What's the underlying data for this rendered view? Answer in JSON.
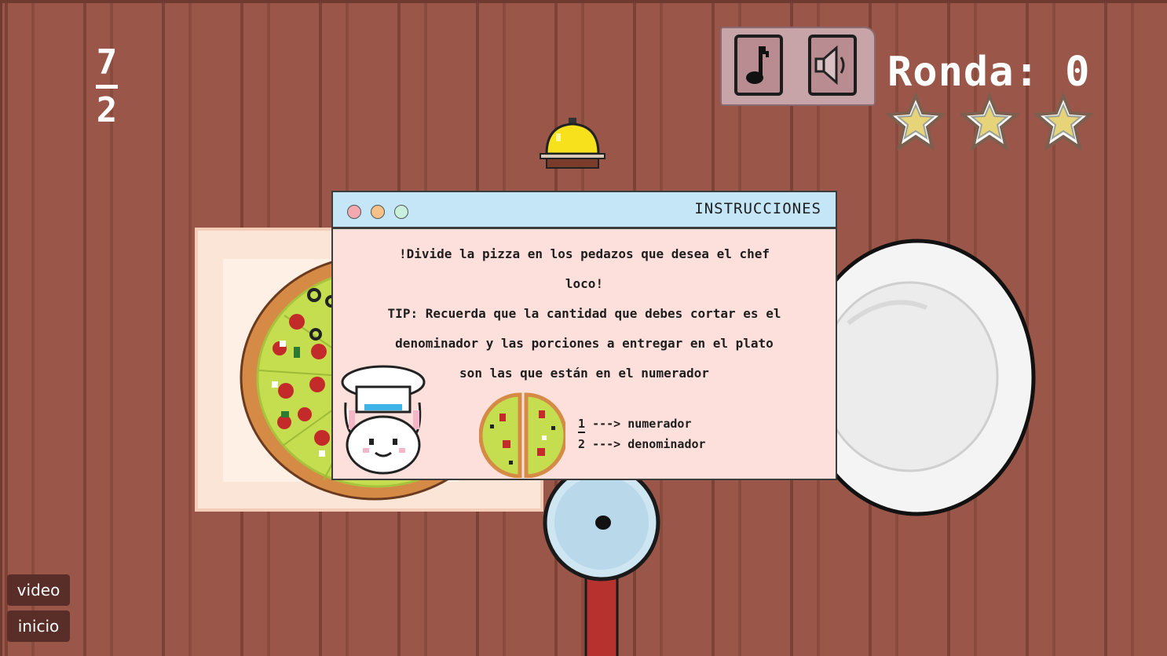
{
  "fraction": {
    "numerator": "7",
    "denominator": "2"
  },
  "round": {
    "label": "Ronda:",
    "value": "0"
  },
  "stars": {
    "count": 3,
    "color": "#e8d478"
  },
  "sound": {
    "music_icon": "music-note-icon",
    "speaker_icon": "speaker-icon"
  },
  "instructions": {
    "title": "INSTRUCCIONES",
    "line1": "!Divide la pizza  en los pedazos que desea el chef",
    "line2": "loco!",
    "line3": "TIP: Recuerda que la cantidad que debes cortar es el",
    "line4": "denominador y las porciones a entregar en el plato",
    "line5": "son las que están en el numerador",
    "legend": {
      "num": "1",
      "num_text": "---> numerador",
      "den": "2",
      "den_text": "---> denominador"
    }
  },
  "nav": {
    "video": "video",
    "inicio": "inicio"
  },
  "colors": {
    "table": "#9a5749",
    "window_bg": "#fde0db",
    "titlebar": "#c4e6f7",
    "pizza_sauce": "#c5de4f",
    "crust": "#d58a45",
    "bell": "#f6e11c"
  }
}
